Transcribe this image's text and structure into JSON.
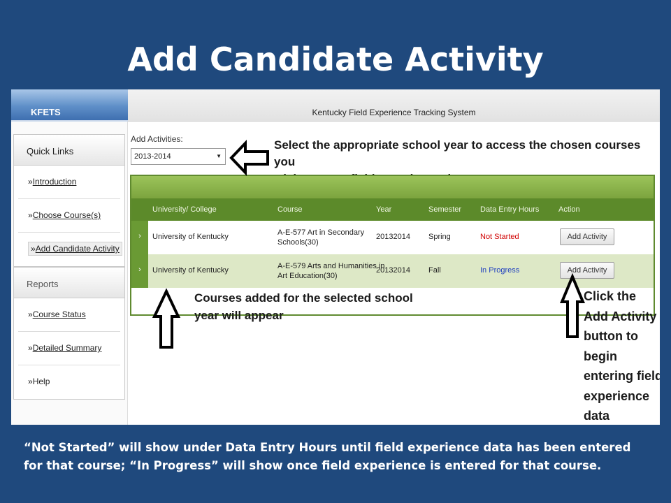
{
  "slide": {
    "title": "Add Candidate Activity",
    "caption": "“Not Started” will show under Data Entry Hours until field experience data has been entered for that course; “In Progress” will show once field experience is entered for that course."
  },
  "app": {
    "brand": "KFETS",
    "system_title": "Kentucky Field Experience Tracking System"
  },
  "sidebar": {
    "quick_links_heading": "Quick Links",
    "quick_links": [
      {
        "label": "Introduction"
      },
      {
        "label": "Choose Course(s)"
      },
      {
        "label": "Add Candidate Activity"
      }
    ],
    "reports_heading": "Reports",
    "reports": [
      {
        "label": "Course Status"
      },
      {
        "label": "Detailed Summary"
      },
      {
        "label": "Help"
      }
    ],
    "bullet": "»"
  },
  "main": {
    "add_activities_label": "Add Activities:",
    "school_year_selected": "2013-2014",
    "table": {
      "columns": [
        "University/ College",
        "Course",
        "Year",
        "Semester",
        "Data Entry Hours",
        "Action"
      ],
      "rows": [
        {
          "university": "University of Kentucky",
          "course_line1": "A-E-577 Art in Secondary",
          "course_line2": "Schools(30)",
          "year": "20132014",
          "semester": "Spring",
          "status": "Not Started",
          "action": "Add Activity"
        },
        {
          "university": "University of Kentucky",
          "course_line1": "A-E-579 Arts and Humanities in",
          "course_line2": "Art Education(30)",
          "year": "20132014",
          "semester": "Fall",
          "status": "In Progress",
          "action": "Add Activity"
        }
      ],
      "expander_glyph": "›"
    }
  },
  "annotations": {
    "select_year_line1": "Select the appropriate school year to access the chosen courses you",
    "select_year_line2": "wish to enter field experience data",
    "courses_line1": "Courses added for the selected school",
    "courses_line2": "year will appear",
    "click_lines": [
      "Click the",
      "Add Activity",
      "button to",
      "begin",
      "entering field",
      "experience",
      "data"
    ]
  },
  "colors": {
    "slide_background": "#1f497d",
    "table_header_green": "#5c8a2a",
    "status_not_started": "#d00000",
    "status_in_progress": "#1f3fbf"
  }
}
